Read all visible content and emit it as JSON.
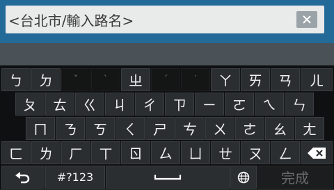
{
  "input": {
    "value": "<台北市/輸入路名>"
  },
  "keyboard": {
    "row1": [
      "ㄅ",
      "ㄉ",
      "ˇ",
      "ˋ",
      "ㄓ",
      "ˊ",
      "˙",
      "ㄚ",
      "ㄞ",
      "ㄢ",
      "ㄦ"
    ],
    "row2": [
      "ㄆ",
      "ㄊ",
      "ㄍ",
      "ㄐ",
      "ㄔ",
      "ㄗ",
      "ㄧ",
      "ㄛ",
      "ㄟ",
      "ㄣ"
    ],
    "row3": [
      "ㄇ",
      "ㄋ",
      "ㄎ",
      "ㄑ",
      "ㄕ",
      "ㄘ",
      "ㄨ",
      "ㄜ",
      "ㄠ",
      "ㄤ"
    ],
    "row4": [
      "ㄈ",
      "ㄌ",
      "ㄏ",
      "ㄒ",
      "ㄖ",
      "ㄙ",
      "ㄩ",
      "ㄝ",
      "ㄡ",
      "ㄥ"
    ],
    "symbols_label": "#?123",
    "done_label": "完成",
    "icons": {
      "clear": "close-icon",
      "backspace": "backspace-icon",
      "back": "return-arrow-icon",
      "space": "space-bar-icon",
      "language": "globe-icon"
    }
  }
}
